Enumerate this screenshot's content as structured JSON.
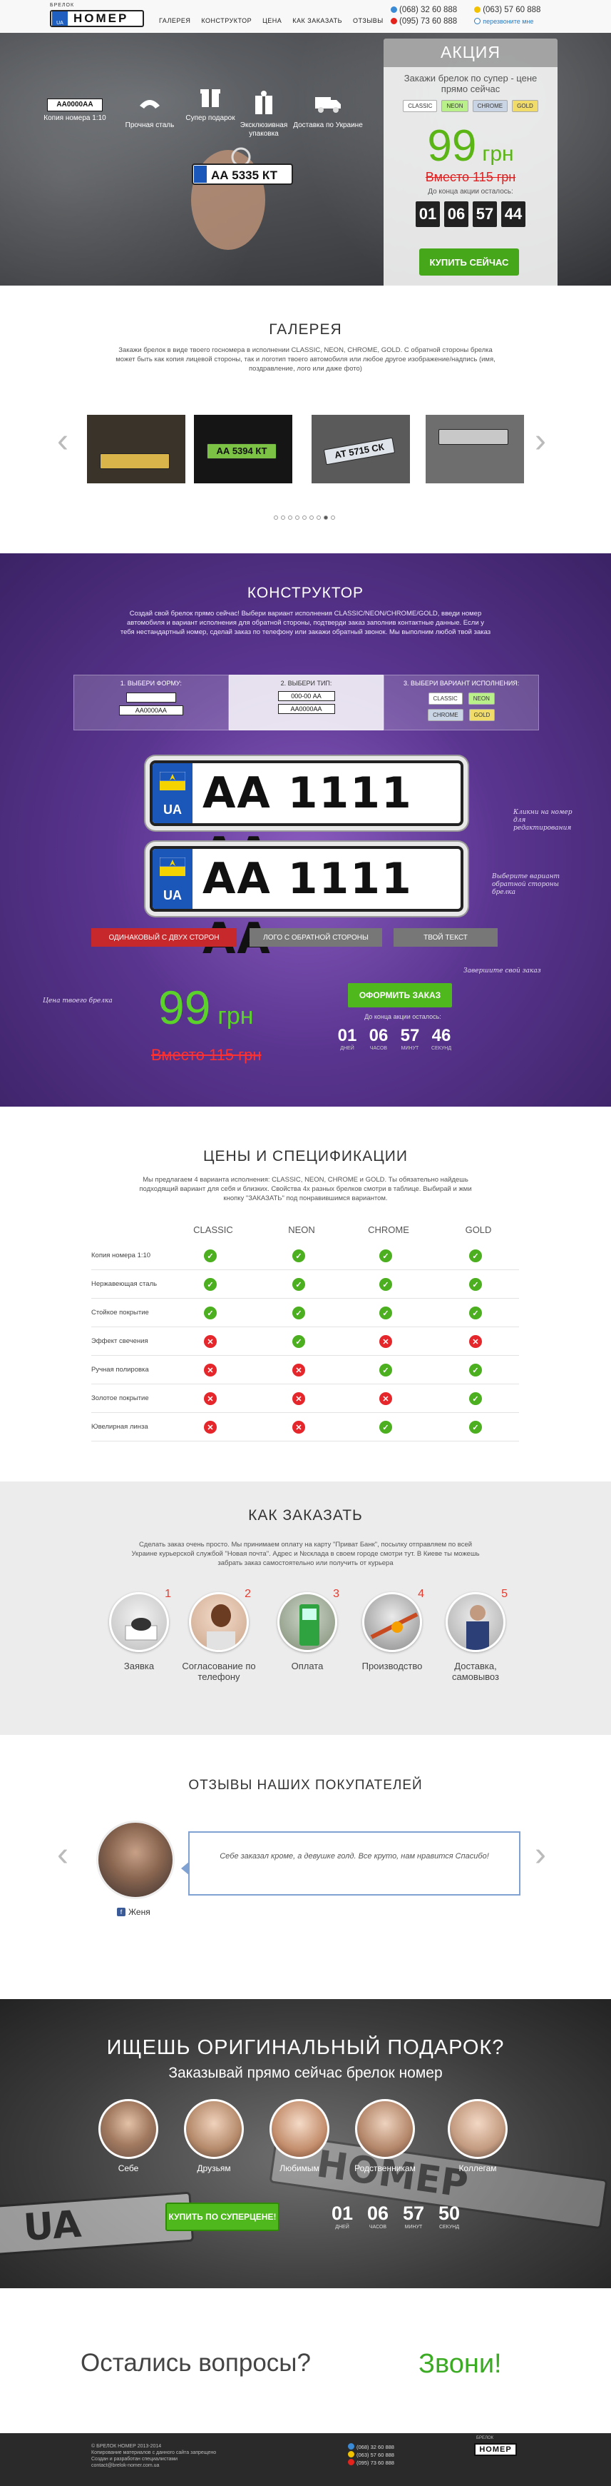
{
  "header": {
    "logo_caption": "БРЕЛОК",
    "logo_text": "НОМЕР",
    "nav": [
      "ГАЛЕРЕЯ",
      "КОНСТРУКТОР",
      "ЦЕНА",
      "КАК ЗАКАЗАТЬ",
      "ОТЗЫВЫ"
    ],
    "phones": [
      "(068) 32 60 888",
      "(063) 57 60 888",
      "(095) 73 60 888"
    ],
    "callback": "перезвоните мне",
    "features": [
      "Копия номера 1:10",
      "Прочная сталь",
      "Супер подарок",
      "Эксклюзивная упаковка",
      "Доставка по Украине"
    ],
    "feature_plate": "АА0000АА",
    "keychain_plate": "АА 5335 КТ"
  },
  "promo": {
    "title": "АКЦИЯ",
    "subtitle": "Закажи брелок по супер - цене прямо сейчас",
    "variants": [
      "CLASSIC",
      "NEON",
      "CHROME",
      "GOLD"
    ],
    "price": "99",
    "currency": "грн",
    "old_price": "Вместо 115 грн",
    "ends": "До конца акции осталось:",
    "timer": [
      "01",
      "06",
      "57",
      "44"
    ],
    "buy": "КУПИТЬ СЕЙЧАС"
  },
  "gallery": {
    "title": "ГАЛЕРЕЯ",
    "text": "Закажи брелок в виде твоего госномера в исполнении CLASSIC, NEON, CHROME, GOLD. С обратной стороны брелка может быть как копия лицевой стороны, так и логотип твоего автомобиля или любое другое изображение/надпись (имя, поздравление, лого или даже фото)",
    "plates": [
      "",
      "АА 5394 КТ",
      "АТ 5715 СК",
      ""
    ]
  },
  "constructor": {
    "title": "КОНСТРУКТОР",
    "text": "Создай свой брелок прямо сейчас! Выбери вариант исполнения CLASSIC/NEON/CHROME/GOLD, введи номер автомобиля и вариант исполнения для обратной стороны, подтверди заказ заполнив контактные данные. Если у тебя нестандартный номер, сделай заказ по телефону или закажи обратный звонок. Мы выполним любой твой заказ",
    "steps": [
      "1. ВЫБЕРИ ФОРМУ:",
      "2. ВЫБЕРИ ТИП:",
      "3. ВЫБЕРИ ВАРИАНТ ИСПОЛНЕНИЯ:"
    ],
    "mini_plates": [
      "АА0000АА",
      "000-00 АА",
      "АА0000АА"
    ],
    "plate": "АА 1111 АА",
    "plate_ua": "UA",
    "note_front": "Кликни на номер для редактирования",
    "note_back": "Выберите вариант обратной стороны брелка",
    "options": [
      "ОДИНАКОВЫЙ С ДВУХ СТОРОН",
      "ЛОГО С ОБРАТНОЙ СТОРОНЫ",
      "ТВОЙ ТЕКСТ"
    ],
    "note_price": "Цена твоего брелка",
    "note_order": "Завершите свой заказ",
    "price": "99",
    "currency": "грн",
    "old_price": "Вместо 115 грн",
    "order": "ОФОРМИТЬ ЗАКАЗ",
    "ends": "До конца акции осталось:",
    "timer": [
      "01",
      "06",
      "57",
      "46"
    ],
    "timer_labels": [
      "ДНЕЙ",
      "ЧАСОВ",
      "МИНУТ",
      "СЕКУНД"
    ]
  },
  "prices": {
    "title": "ЦЕНЫ И СПЕЦИФИКАЦИИ",
    "text": "Мы предлагаем 4 варианта исполнения: CLASSIC, NEON, CHROME и GOLD. Ты обязательно найдешь подходящий вариант для себя и близких. Свойства 4х разных брелков смотри в таблице. Выбирай и жми кнопку \"ЗАКАЗАТЬ\" под понравившимся вариантом.",
    "columns": [
      "CLASSIC",
      "NEON",
      "CHROME",
      "GOLD"
    ],
    "rows": [
      {
        "label": "Копия номера 1:10",
        "v": [
          1,
          1,
          1,
          1
        ]
      },
      {
        "label": "Нержавеющая сталь",
        "v": [
          1,
          1,
          1,
          1
        ]
      },
      {
        "label": "Стойкое покрытие",
        "v": [
          1,
          1,
          1,
          1
        ]
      },
      {
        "label": "Эффект свечения",
        "v": [
          0,
          1,
          0,
          0
        ]
      },
      {
        "label": "Ручная полировка",
        "v": [
          0,
          0,
          1,
          1
        ]
      },
      {
        "label": "Золотое покрытие",
        "v": [
          0,
          0,
          0,
          1
        ]
      },
      {
        "label": "Ювелирная линза",
        "v": [
          0,
          0,
          1,
          1
        ]
      }
    ]
  },
  "how": {
    "title": "КАК ЗАКАЗАТЬ",
    "text": "Сделать заказ очень просто. Мы принимаем оплату на карту \"Приват Банк\", посылку отправляем по всей Украине курьерской службой \"Новая почта\". Адрес и №склада в своем городе смотри тут. В Киеве ты можешь забрать заказ самостоятельно или получить от курьера",
    "steps": [
      "Заявка",
      "Согласование по телефону",
      "Оплата",
      "Производство",
      "Доставка, самовывоз"
    ],
    "numbers": [
      "1",
      "2",
      "3",
      "4",
      "5"
    ]
  },
  "reviews": {
    "title": "ОТЗЫВЫ НАШИХ ПОКУПАТЕЛЕЙ",
    "text": "Себе заказал кроме, а девушке голд. Все круто, нам нравится Спасибо!",
    "author": "Женя"
  },
  "gift": {
    "title": "ИЩЕШЬ ОРИГИНАЛЬНЫЙ ПОДАРОК?",
    "subtitle": "Заказывай прямо сейчас брелок номер",
    "people": [
      "Себе",
      "Друзьям",
      "Любимым",
      "Родственникам",
      "Коллегам"
    ],
    "button": "КУПИТЬ ПО СУПЕРЦЕНЕ!",
    "timer": [
      "01",
      "06",
      "57",
      "50"
    ],
    "timer_labels": [
      "ДНЕЙ",
      "ЧАСОВ",
      "МИНУТ",
      "СЕКУНД"
    ]
  },
  "questions": {
    "left": "Остались вопросы?",
    "right": "Звони!"
  },
  "footer": {
    "lines": [
      "© БРЕЛОК НОМЕР 2013-2014",
      "Копирование материалов с данного сайта запрещено",
      "Создан и разработан специалистами",
      "contact@brelok-nomer.com.ua"
    ],
    "phones": [
      "(068) 32 60 888",
      "(063) 57 60 888",
      "(095) 73 60 888"
    ],
    "logo_caption": "БРЕЛОК",
    "logo": "НОМЕР"
  },
  "colors": {
    "accent": "#4fb81d",
    "old_price": "#e02020",
    "purple": "#5a3590"
  }
}
